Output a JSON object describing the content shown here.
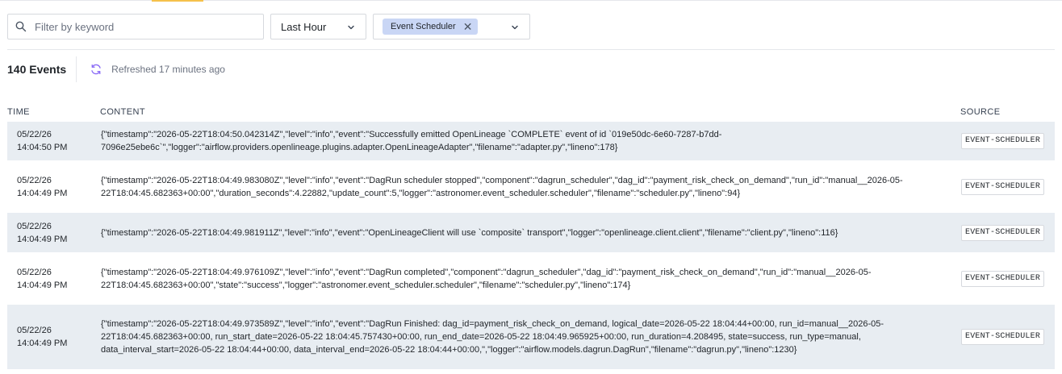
{
  "filters": {
    "search_placeholder": "Filter by keyword",
    "time_range": "Last Hour",
    "source_chip": "Event Scheduler"
  },
  "summary": {
    "count": "140 Events",
    "refreshed": "Refreshed 17 minutes ago"
  },
  "table": {
    "headers": {
      "time": "TIME",
      "content": "CONTENT",
      "source": "SOURCE"
    },
    "rows": [
      {
        "date": "05/22/26",
        "time": "14:04:50 PM",
        "content": "{\"timestamp\":\"2026-05-22T18:04:50.042314Z\",\"level\":\"info\",\"event\":\"Successfully emitted OpenLineage `COMPLETE` event of id `019e50dc-6e60-7287-b7dd-7096e25ebe6c`\",\"logger\":\"airflow.providers.openlineage.plugins.adapter.OpenLineageAdapter\",\"filename\":\"adapter.py\",\"lineno\":178}",
        "source": "EVENT-SCHEDULER"
      },
      {
        "date": "05/22/26",
        "time": "14:04:49 PM",
        "content": "{\"timestamp\":\"2026-05-22T18:04:49.983080Z\",\"level\":\"info\",\"event\":\"DagRun scheduler stopped\",\"component\":\"dagrun_scheduler\",\"dag_id\":\"payment_risk_check_on_demand\",\"run_id\":\"manual__2026-05-22T18:04:45.682363+00:00\",\"duration_seconds\":4.22882,\"update_count\":5,\"logger\":\"astronomer.event_scheduler.scheduler\",\"filename\":\"scheduler.py\",\"lineno\":94}",
        "source": "EVENT-SCHEDULER"
      },
      {
        "date": "05/22/26",
        "time": "14:04:49 PM",
        "content": "{\"timestamp\":\"2026-05-22T18:04:49.981911Z\",\"level\":\"info\",\"event\":\"OpenLineageClient will use `composite` transport\",\"logger\":\"openlineage.client.client\",\"filename\":\"client.py\",\"lineno\":116}",
        "source": "EVENT-SCHEDULER"
      },
      {
        "date": "05/22/26",
        "time": "14:04:49 PM",
        "content": "{\"timestamp\":\"2026-05-22T18:04:49.976109Z\",\"level\":\"info\",\"event\":\"DagRun completed\",\"component\":\"dagrun_scheduler\",\"dag_id\":\"payment_risk_check_on_demand\",\"run_id\":\"manual__2026-05-22T18:04:45.682363+00:00\",\"state\":\"success\",\"logger\":\"astronomer.event_scheduler.scheduler\",\"filename\":\"scheduler.py\",\"lineno\":174}",
        "source": "EVENT-SCHEDULER"
      },
      {
        "date": "05/22/26",
        "time": "14:04:49 PM",
        "content": "{\"timestamp\":\"2026-05-22T18:04:49.973589Z\",\"level\":\"info\",\"event\":\"DagRun Finished: dag_id=payment_risk_check_on_demand, logical_date=2026-05-22 18:04:44+00:00, run_id=manual__2026-05-22T18:04:45.682363+00:00, run_start_date=2026-05-22 18:04:45.757430+00:00, run_end_date=2026-05-22 18:04:49.965925+00:00, run_duration=4.208495, state=success, run_type=manual, data_interval_start=2026-05-22 18:04:44+00:00, data_interval_end=2026-05-22 18:04:44+00:00,\",\"logger\":\"airflow.models.dagrun.DagRun\",\"filename\":\"dagrun.py\",\"lineno\":1230}",
        "source": "EVENT-SCHEDULER"
      }
    ]
  },
  "colors": {
    "row_stripe": "#e8edf2",
    "chip_bg": "#c9d6f5",
    "refresh_icon": "#7c5cff"
  }
}
